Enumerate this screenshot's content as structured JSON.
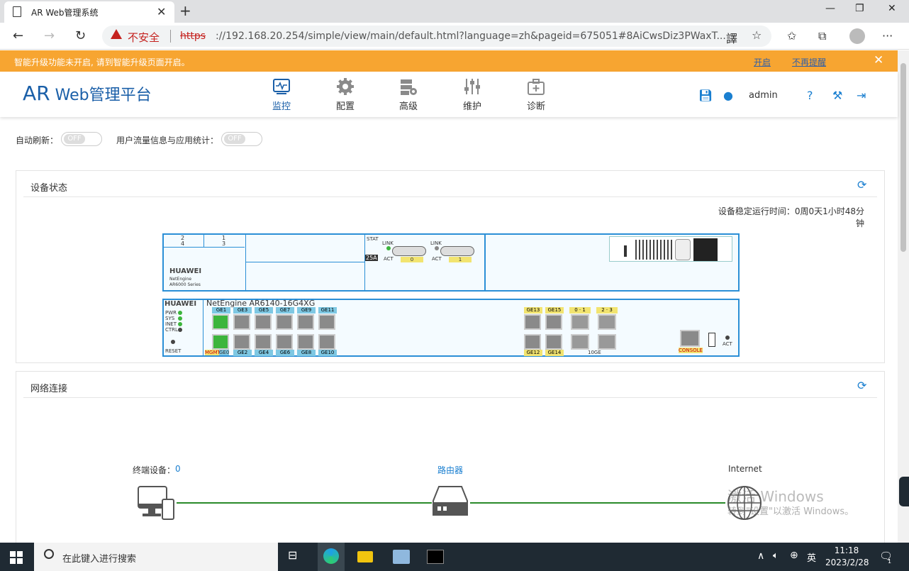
{
  "browser": {
    "tab_title": "AR Web管理系统",
    "security_label": "不安全",
    "url_protocol": "https",
    "url_rest": "://192.168.20.254/simple/view/main/default.html?language=zh&pageid=675051#8AiCwsDiz3PWaxT..."
  },
  "notice": {
    "text": "智能升级功能未开启, 请到智能升级页面开启。",
    "open_link": "开启",
    "dismiss_link": "不再提醒"
  },
  "header": {
    "logo_ar": "AR",
    "logo_rest": " Web管理平台",
    "nav": [
      {
        "label": "监控"
      },
      {
        "label": "配置"
      },
      {
        "label": "高级"
      },
      {
        "label": "维护"
      },
      {
        "label": "诊断"
      }
    ],
    "user": "admin"
  },
  "toggles": {
    "auto_refresh_label": "自动刷新：",
    "auto_refresh_state": "OFF",
    "traffic_label": "用户流量信息与应用统计：",
    "traffic_state": "OFF"
  },
  "device_panel": {
    "title": "设备状态",
    "uptime": "设备稳定运行时间：0周0天1小时48分钟",
    "brand": "HUAWEI",
    "series1": "NetEngine",
    "series2": "AR6000 Series",
    "model": "NetEngine AR6140-16G4XG",
    "card_slots": [
      "2",
      "1",
      "4",
      "3"
    ],
    "stat": "STAT",
    "link": "LINK",
    "act": "ACT",
    "card_25a": "25A",
    "card_port0": "0",
    "card_port1": "1",
    "leds": [
      "PWR",
      "SYS",
      "INET",
      "CTRL"
    ],
    "reset": "RESET",
    "top_ports": [
      "GE1",
      "GE3",
      "GE5",
      "GE7",
      "GE9",
      "GE11"
    ],
    "bottom_ports": [
      "GE2",
      "GE4",
      "GE6",
      "GE8",
      "GE10"
    ],
    "mgmt": "MGMT",
    "ge0": "GE0",
    "ge13": "GE13",
    "ge15": "GE15",
    "ge12": "GE12",
    "ge14": "GE14",
    "tge_top": [
      "0",
      "1",
      "2",
      "3"
    ],
    "tge_label": "10GE",
    "console": "CONSOLE",
    "act2": "ACT"
  },
  "network_panel": {
    "title": "网络连接",
    "terminals_label": "终端设备：",
    "terminals_count": "0",
    "router_label": "路由器",
    "internet_label": "Internet"
  },
  "watermark": {
    "line1": "激活 Windows",
    "line2": "转到\"设置\"以激活 Windows。"
  },
  "taskbar": {
    "search_placeholder": "在此键入进行搜索",
    "ime": "英",
    "time": "11:18",
    "date": "2023/2/28",
    "notification_count": "1"
  }
}
